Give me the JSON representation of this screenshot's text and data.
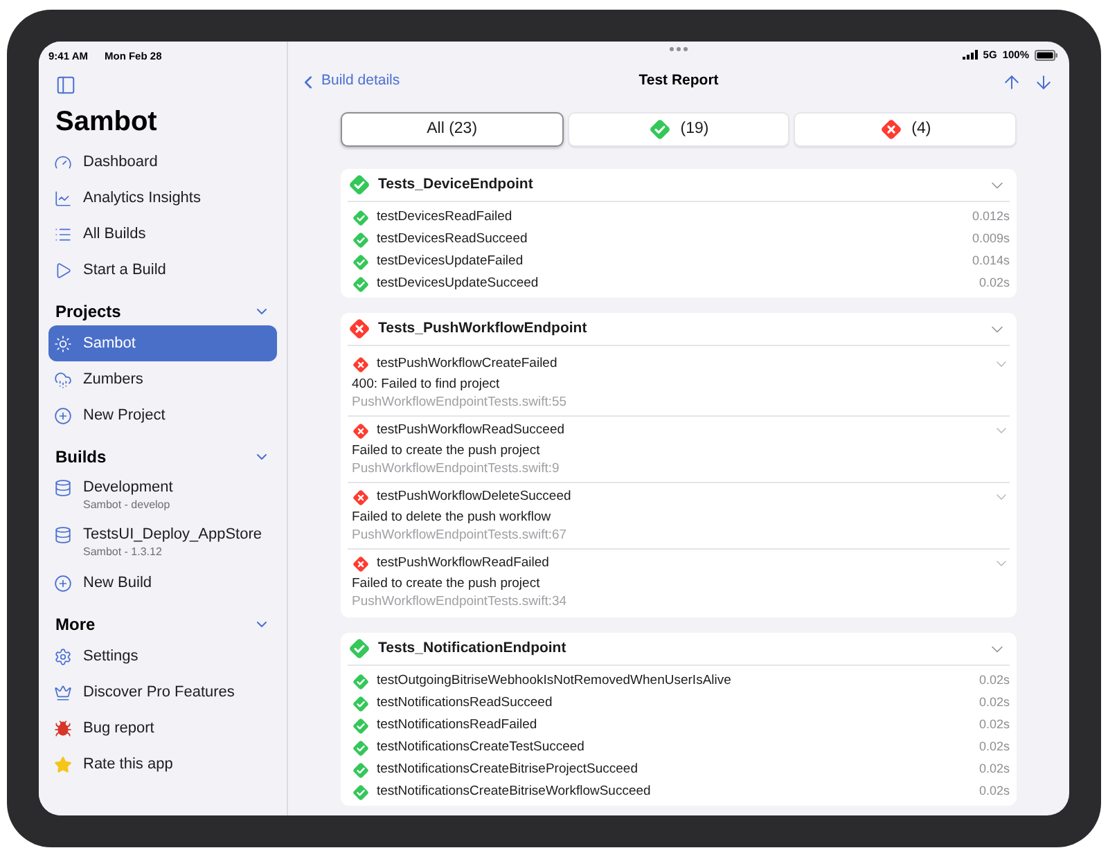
{
  "status_bar": {
    "time": "9:41 AM",
    "date": "Mon Feb 28",
    "network": "5G",
    "battery": "100%"
  },
  "sidebar": {
    "title": "Sambot",
    "nav": [
      {
        "label": "Dashboard",
        "selected": false
      },
      {
        "label": "Analytics Insights",
        "selected": false
      },
      {
        "label": "All Builds",
        "selected": false
      },
      {
        "label": "Start a Build",
        "selected": false
      }
    ],
    "sections": [
      {
        "title": "Projects",
        "expanded": true,
        "items": [
          {
            "label": "Sambot",
            "selected": true
          },
          {
            "label": "Zumbers",
            "selected": false
          },
          {
            "label": "New Project",
            "selected": false
          }
        ]
      },
      {
        "title": "Builds",
        "expanded": true,
        "items": [
          {
            "label": "Development",
            "subtitle": "Sambot - develop",
            "selected": false
          },
          {
            "label": "TestsUI_Deploy_AppStore",
            "subtitle": "Sambot - 1.3.12",
            "selected": false
          },
          {
            "label": "New Build",
            "selected": false
          }
        ]
      },
      {
        "title": "More",
        "expanded": true,
        "items": [
          {
            "label": "Settings",
            "selected": false
          },
          {
            "label": "Discover Pro Features",
            "selected": false
          },
          {
            "label": "Bug report",
            "selected": false
          },
          {
            "label": "Rate this app",
            "selected": false
          }
        ]
      }
    ]
  },
  "nav_bar": {
    "back": "Build details",
    "title": "Test Report"
  },
  "filters": [
    {
      "kind": "all",
      "label": "All (23)",
      "selected": true
    },
    {
      "kind": "passed",
      "label": "(19)",
      "selected": false
    },
    {
      "kind": "failed",
      "label": "(4)",
      "selected": false
    }
  ],
  "suites": [
    {
      "name": "Tests_DeviceEndpoint",
      "kind": "passed",
      "expanded": true,
      "tests": [
        {
          "name": "testDevicesReadFailed",
          "kind": "passed",
          "duration": "0.012s"
        },
        {
          "name": "testDevicesReadSucceed",
          "kind": "passed",
          "duration": "0.009s"
        },
        {
          "name": "testDevicesUpdateFailed",
          "kind": "passed",
          "duration": "0.014s"
        },
        {
          "name": "testDevicesUpdateSucceed",
          "kind": "passed",
          "duration": "0.02s"
        }
      ]
    },
    {
      "name": "Tests_PushWorkflowEndpoint",
      "kind": "failed",
      "expanded": true,
      "tests": [
        {
          "name": "testPushWorkflowCreateFailed",
          "kind": "failed",
          "message": "400: Failed to find project",
          "location": "PushWorkflowEndpointTests.swift:55"
        },
        {
          "name": "testPushWorkflowReadSucceed",
          "kind": "failed",
          "message": "Failed to create the push project",
          "location": "PushWorkflowEndpointTests.swift:9"
        },
        {
          "name": "testPushWorkflowDeleteSucceed",
          "kind": "failed",
          "message": "Failed to delete the push workflow",
          "location": "PushWorkflowEndpointTests.swift:67"
        },
        {
          "name": "testPushWorkflowReadFailed",
          "kind": "failed",
          "message": "Failed to create the push project",
          "location": "PushWorkflowEndpointTests.swift:34"
        }
      ]
    },
    {
      "name": "Tests_NotificationEndpoint",
      "kind": "passed",
      "expanded": true,
      "tests": [
        {
          "name": "testOutgoingBitriseWebhookIsNotRemovedWhenUserIsAlive",
          "kind": "passed",
          "duration": "0.02s"
        },
        {
          "name": "testNotificationsReadSucceed",
          "kind": "passed",
          "duration": "0.02s"
        },
        {
          "name": "testNotificationsReadFailed",
          "kind": "passed",
          "duration": "0.02s"
        },
        {
          "name": "testNotificationsCreateTestSucceed",
          "kind": "passed",
          "duration": "0.02s"
        },
        {
          "name": "testNotificationsCreateBitriseProjectSucceed",
          "kind": "passed",
          "duration": "0.02s"
        },
        {
          "name": "testNotificationsCreateBitriseWorkflowSucceed",
          "kind": "passed",
          "duration": "0.02s"
        }
      ]
    }
  ]
}
